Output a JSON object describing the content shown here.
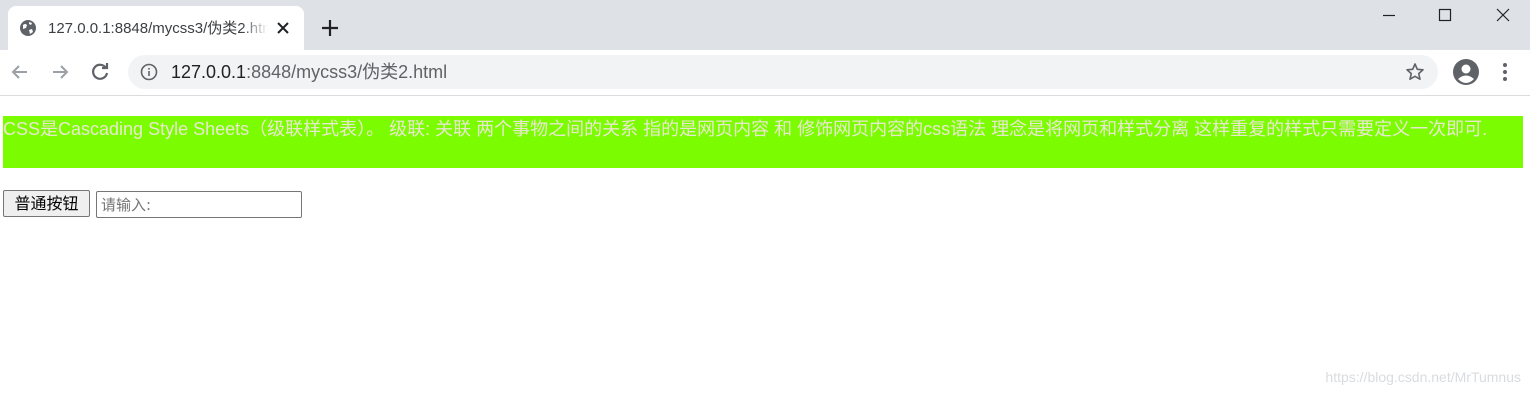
{
  "browser": {
    "tab": {
      "title": "127.0.0.1:8848/mycss3/伪类2.html"
    },
    "address": {
      "host": "127.0.0.1",
      "rest": ":8848/mycss3/伪类2.html"
    },
    "icons": {
      "favicon": "globe-icon",
      "tab_close": "close-icon",
      "new_tab": "plus-icon",
      "minimize": "minimize-icon",
      "maximize": "maximize-icon",
      "close_window": "close-window-icon",
      "back": "arrow-left-icon",
      "forward": "arrow-right-icon",
      "reload": "reload-icon",
      "site_info": "info-icon",
      "bookmark": "star-icon",
      "profile": "profile-icon",
      "menu": "kebab-menu-icon"
    },
    "colors": {
      "tabstrip_bg": "#dee1e6",
      "omnibox_bg": "#f1f3f4"
    }
  },
  "page": {
    "paragraph": "CSS是Cascading Style Sheets（级联样式表）。 级联: 关联 两个事物之间的关系 指的是网页内容 和 修饰网页内容的css语法 理念是将网页和样式分离 这样重复的样式只需要定义一次即可.",
    "button_label": "普通按钮",
    "input_placeholder": "请输入:",
    "input_value": "",
    "watermark": "https://blog.csdn.net/MrTumnus",
    "colors": {
      "paragraph_bg": "#7cfc00",
      "paragraph_text": "#e8e8d0"
    }
  }
}
